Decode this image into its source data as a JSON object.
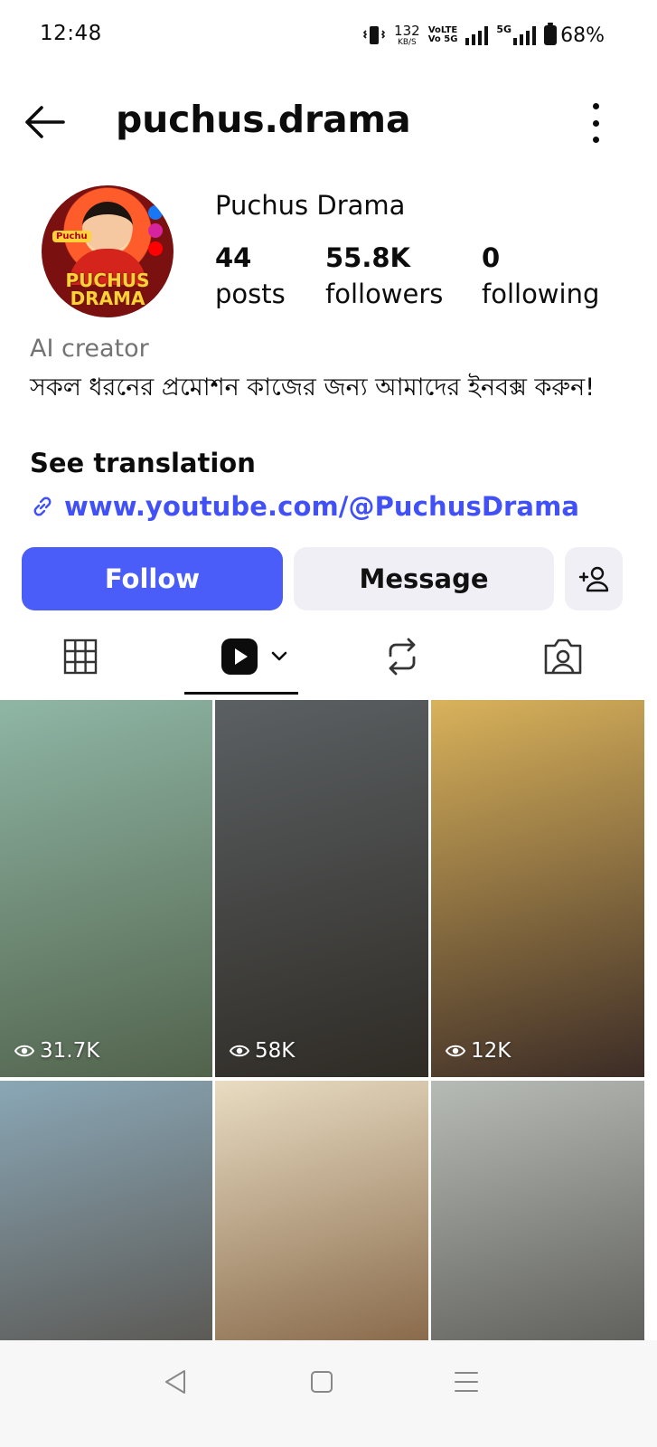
{
  "status_bar": {
    "time": "12:48",
    "speed_value": "132",
    "speed_unit": "KB/S",
    "volte_top": "VoLTE",
    "volte_bottom": "Vo 5G",
    "network": "5G",
    "battery": "68%"
  },
  "header": {
    "username": "puchus.drama"
  },
  "profile": {
    "display_name": "Puchus Drama",
    "avatar_text": "PUCHUS DRAMA",
    "avatar_tag": "Puchu",
    "stats": [
      {
        "value": "44",
        "label": "posts"
      },
      {
        "value": "55.8K",
        "label": "followers"
      },
      {
        "value": "0",
        "label": "following"
      }
    ],
    "category": "AI creator",
    "bio": "সকল ধরনের প্রমোশন কাজের জন্য আমাদের ইনবক্স করুন!",
    "see_translation": "See translation",
    "link": "www.youtube.com/@PuchusDrama"
  },
  "actions": {
    "follow": "Follow",
    "message": "Message"
  },
  "tabs": [
    "grid-icon",
    "reels-icon",
    "reposts-icon",
    "tagged-icon"
  ],
  "posts": [
    {
      "views": "31.7K",
      "colors": [
        "#8fb6a5",
        "#52634c"
      ]
    },
    {
      "views": "58K",
      "colors": [
        "#5b6063",
        "#2f2b25"
      ]
    },
    {
      "views": "12K",
      "colors": [
        "#d9b25b",
        "#3c2c26"
      ]
    },
    {
      "views": "",
      "colors": [
        "#8aa7b6",
        "#5c5a56"
      ]
    },
    {
      "views": "",
      "colors": [
        "#e8dcc2",
        "#8a6b4c"
      ]
    },
    {
      "views": "",
      "colors": [
        "#b7bbb6",
        "#61615d"
      ]
    }
  ],
  "colors": {
    "accent": "#4a5df9",
    "link": "#4150f7",
    "secondary_bg": "#efeff5",
    "muted_text": "#737373"
  }
}
